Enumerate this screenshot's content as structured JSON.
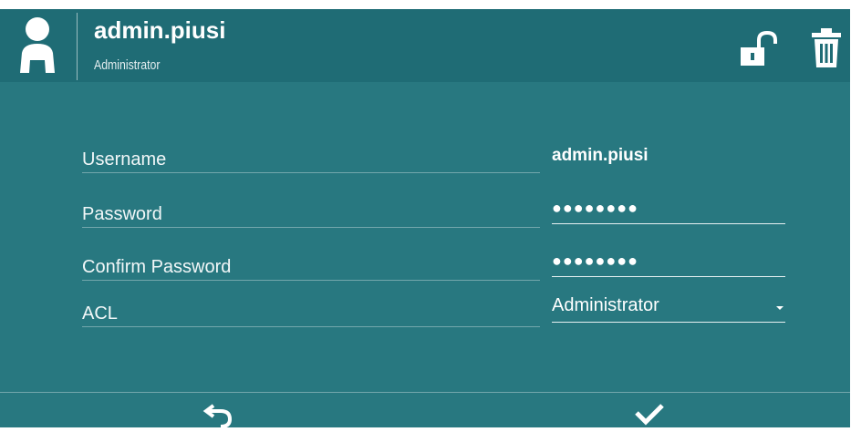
{
  "header": {
    "username": "admin.piusi",
    "role": "Administrator",
    "icons": {
      "avatar": "user-avatar-icon",
      "lock": "unlock-icon",
      "delete": "trash-icon"
    }
  },
  "form": {
    "username": {
      "label": "Username",
      "value": "admin.piusi"
    },
    "password": {
      "label": "Password",
      "value": "●●●●●●●●"
    },
    "confirm_password": {
      "label": "Confirm Password",
      "value": "●●●●●●●●"
    },
    "acl": {
      "label": "ACL",
      "value": "Administrator"
    }
  },
  "footer": {
    "icons": {
      "undo": "undo-icon",
      "confirm": "checkmark-icon"
    }
  },
  "colors": {
    "header_bg": "#1f6c75",
    "body_bg": "#287880",
    "text": "#ffffff"
  }
}
